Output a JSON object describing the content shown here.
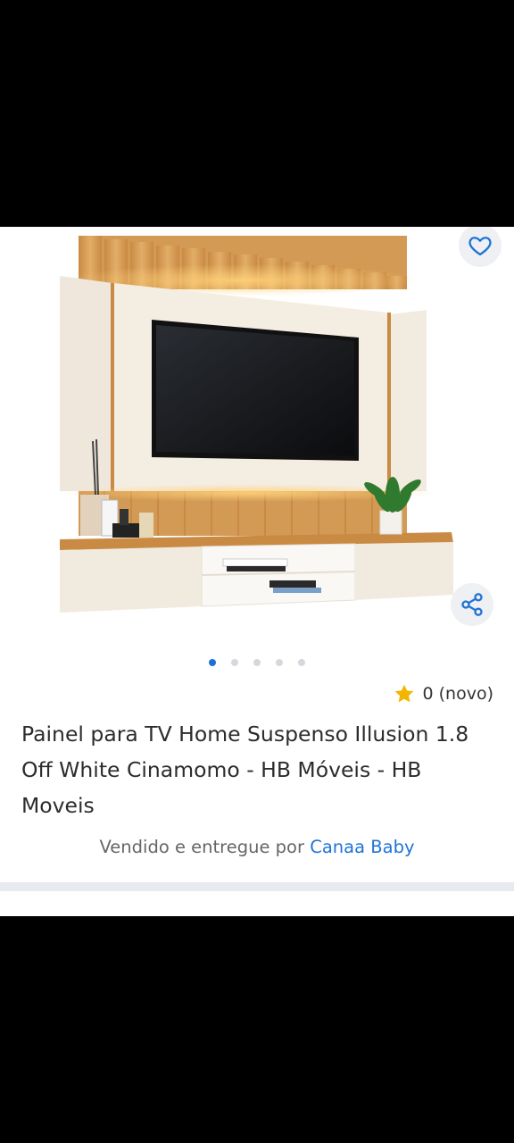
{
  "product": {
    "rating_text": "0 (novo)",
    "title": "Painel para TV Home Suspenso Illusion 1.8 Off White Cinamomo - HB Móveis - HB Moveis",
    "sold_by_prefix": "Vendido e entregue por",
    "seller_name": "Canaa Baby"
  },
  "carousel": {
    "total_images": 5,
    "active_index": 0
  },
  "icons": {
    "favorite": "heart-icon",
    "share": "share-icon",
    "rating": "star-icon"
  },
  "colors": {
    "accent": "#1e6fd9",
    "star": "#f2b500",
    "panel": "#f1e9dd",
    "wood": "#d39a55",
    "light": "#ffcc66"
  }
}
